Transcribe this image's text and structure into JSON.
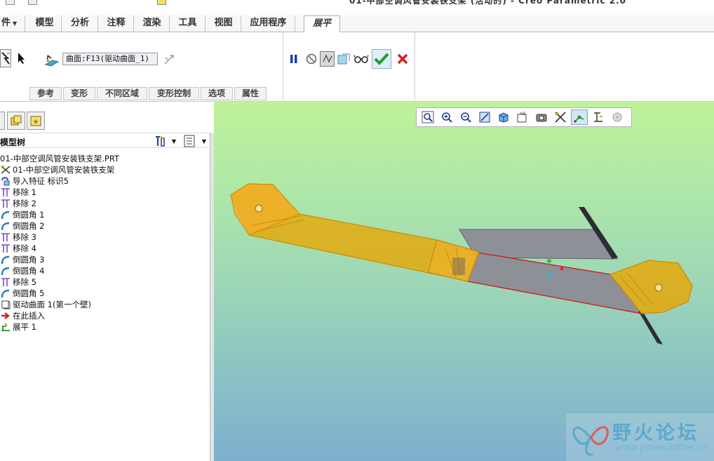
{
  "window": {
    "title": "01-中部空调风管安装铁支架 (活动的) - Creo Parametric 2.0"
  },
  "tabs": [
    {
      "label": "件",
      "has_menu": true
    },
    {
      "label": "模型"
    },
    {
      "label": "分析"
    },
    {
      "label": "注释"
    },
    {
      "label": "渲染"
    },
    {
      "label": "工具"
    },
    {
      "label": "视图"
    },
    {
      "label": "应用程序"
    },
    {
      "label": "展平",
      "active": true
    }
  ],
  "ribbon": {
    "reference_value": "曲面:F13(驱动曲面_1)",
    "subtabs": [
      "参考",
      "变形",
      "不同区域",
      "变形控制",
      "选项",
      "属性"
    ],
    "actions": [
      "pause-icon",
      "stop-icon",
      "preview-icon",
      "verify-icon",
      "glasses-icon",
      "apply-checkmark-icon",
      "cancel-x-icon"
    ]
  },
  "tree": {
    "title": "模型树",
    "items": [
      {
        "label": "01-中部空调风管安装铁支架.PRT",
        "icon": "none"
      },
      {
        "label": "01-中部空调风管安装铁支架",
        "icon": "csys-icon"
      },
      {
        "label": "导入特征 标识5",
        "icon": "import-icon"
      },
      {
        "label": "移除 1",
        "icon": "remove-icon"
      },
      {
        "label": "移除 2",
        "icon": "remove-icon"
      },
      {
        "label": "倒圆角 1",
        "icon": "round-icon"
      },
      {
        "label": "倒圆角 2",
        "icon": "round-icon"
      },
      {
        "label": "移除 3",
        "icon": "remove-icon"
      },
      {
        "label": "移除 4",
        "icon": "remove-icon"
      },
      {
        "label": "倒圆角 3",
        "icon": "round-icon"
      },
      {
        "label": "倒圆角 4",
        "icon": "round-icon"
      },
      {
        "label": "移除 5",
        "icon": "remove-icon"
      },
      {
        "label": "倒圆角 5",
        "icon": "round-icon"
      },
      {
        "label": "驱动曲面 1(第一个壁)",
        "icon": "driving-surface-icon"
      },
      {
        "label": "在此插入",
        "icon": "insert-arrow-icon"
      },
      {
        "label": "展平 1",
        "icon": "flatten-icon"
      }
    ]
  },
  "view_toolbar": {
    "buttons": [
      "refit-icon",
      "zoom-in-icon",
      "zoom-out-icon",
      "repaint-icon",
      "display-style-icon",
      "saved-views-icon",
      "view-manager-icon",
      "datum-display-icon",
      "spin-center-icon",
      "annotation-display-icon",
      "appearance-icon"
    ],
    "active_index": 8
  },
  "watermark": {
    "text": "野火论坛",
    "url": "www.proewildfire.cn"
  },
  "colors": {
    "part_orange": "#e8a500",
    "part_gray": "#8d9197",
    "accent_green": "#1ea02a",
    "cancel_red": "#d62020"
  }
}
